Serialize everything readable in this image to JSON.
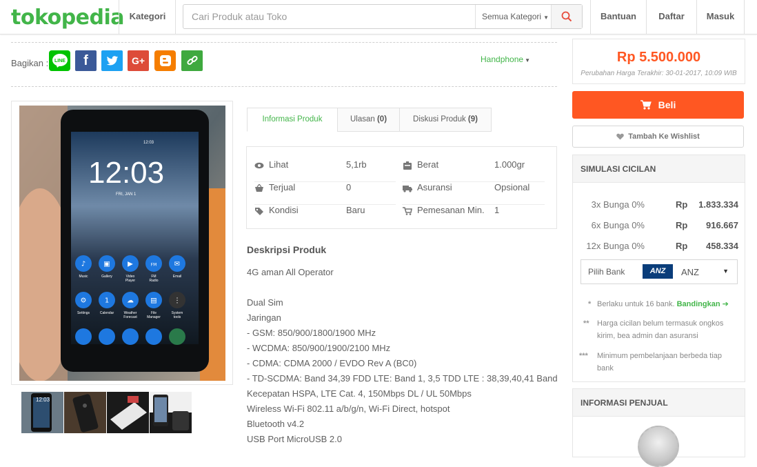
{
  "header": {
    "logo": "tokopedia",
    "kategori_label": "Kategori",
    "search_placeholder": "Cari Produk atau Toko",
    "search_category": "Semua Kategori",
    "links": [
      "Bantuan",
      "Daftar",
      "Masuk"
    ]
  },
  "share": {
    "label": "Bagikan :",
    "buttons": [
      {
        "name": "line",
        "text": "LINE",
        "color": "#00c300"
      },
      {
        "name": "facebook",
        "text": "f",
        "color": "#3b5998"
      },
      {
        "name": "twitter",
        "text": "t",
        "color": "#1da1f2"
      },
      {
        "name": "google-plus",
        "text": "G+",
        "color": "#dd4b39"
      },
      {
        "name": "blogger",
        "text": "B",
        "color": "#f57d00"
      },
      {
        "name": "link",
        "text": "link",
        "color": "#3fa93f"
      }
    ]
  },
  "category_dropdown": "Handphone",
  "tabs": [
    {
      "label": "Informasi Produk",
      "count": ""
    },
    {
      "label": "Ulasan",
      "count": "(0)"
    },
    {
      "label": "Diskusi Produk",
      "count": "(9)"
    }
  ],
  "product_info": {
    "left": [
      {
        "icon": "eye-icon",
        "label": "Lihat",
        "value": "5,1rb"
      },
      {
        "icon": "basket-icon",
        "label": "Terjual",
        "value": "0"
      },
      {
        "icon": "tag-icon",
        "label": "Kondisi",
        "value": "Baru"
      }
    ],
    "right": [
      {
        "icon": "weight-icon",
        "label": "Berat",
        "value": "1.000gr"
      },
      {
        "icon": "truck-icon",
        "label": "Asuransi",
        "value": "Opsional"
      },
      {
        "icon": "cart-icon",
        "label": "Pemesanan Min.",
        "value": "1"
      }
    ]
  },
  "description": {
    "title": "Deskripsi Produk",
    "lines": [
      "4G aman All Operator",
      "",
      "Dual Sim",
      "Jaringan",
      "- GSM: 850/900/1800/1900 MHz",
      "- WCDMA: 850/900/1900/2100 MHz",
      "- CDMA: CDMA 2000 / EVDO Rev A (BC0)",
      "- TD-SCDMA: Band 34,39 FDD LTE: Band 1, 3,5 TDD LTE : 38,39,40,41 Band",
      "Kecepatan HSPA, LTE Cat. 4, 150Mbps DL / UL 50Mbps",
      "Wireless Wi-Fi 802.11 a/b/g/n, Wi-Fi Direct, hotspot",
      "Bluetooth v4.2",
      "USB Port MicroUSB 2.0"
    ]
  },
  "phone_screen": {
    "status_time": "12:03",
    "clock": "12:03",
    "date": "FRI, JAN 1",
    "apps": [
      "Music",
      "Gallery",
      "Video Player",
      "FM Radio",
      "Email",
      "Settings",
      "Calendar",
      "Weather Forecast",
      "File Manager",
      "System tools"
    ],
    "calendar_day": "1"
  },
  "thumbnails": [
    "thumb-1",
    "thumb-2",
    "thumb-3",
    "thumb-4"
  ],
  "price": {
    "amount": "Rp 5.500.000",
    "last_change": "Perubahan Harga Terakhir: 30-01-2017, 10:09 WIB"
  },
  "buy_label": "Beli",
  "wishlist_label": "Tambah Ke Wishlist",
  "installment": {
    "title": "SIMULASI CICILAN",
    "rows": [
      {
        "term": "3x  Bunga 0%",
        "currency": "Rp",
        "amount": "1.833.334"
      },
      {
        "term": "6x  Bunga 0%",
        "currency": "Rp",
        "amount": "916.667"
      },
      {
        "term": "12x  Bunga 0%",
        "currency": "Rp",
        "amount": "458.334"
      }
    ],
    "bank_label": "Pilih Bank",
    "bank_logo": "ANZ",
    "bank_name": "ANZ",
    "note1": "Berlaku untuk 16 bank.",
    "note1_link": "Bandingkan",
    "note2": "Harga cicilan belum termasuk ongkos kirim, bea admin dan asuransi",
    "note3": "Minimum pembelanjaan berbeda tiap bank"
  },
  "seller": {
    "title": "INFORMASI PENJUAL"
  },
  "colors": {
    "brand_green": "#42b549",
    "price_orange": "#ff5722"
  }
}
